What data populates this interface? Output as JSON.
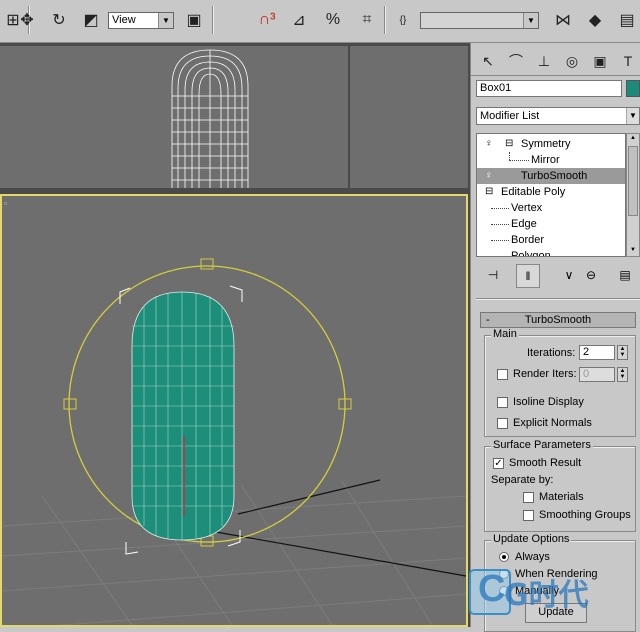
{
  "toolbar": {
    "view_select": "View",
    "named_selection": "",
    "icons": [
      "select-link-icon",
      "move-icon",
      "rotate-icon",
      "scale-icon",
      "view-dropdown",
      "use-pivot-icon",
      "snap-icon",
      "angle-snap-icon",
      "percent-snap-icon",
      "spinner-snap-icon",
      "mirror-icon",
      "align-icon",
      "named-selection-field",
      "edit-named-sel-icon",
      "material-editor-icon"
    ]
  },
  "panel": {
    "object_name": "Box01",
    "object_color": "#1a8a7a",
    "modifier_list": "Modifier List",
    "stack": [
      {
        "label": "Symmetry",
        "level": 0
      },
      {
        "label": "Mirror",
        "level": 1
      },
      {
        "label": "TurboSmooth",
        "level": 0,
        "selected": true
      },
      {
        "label": "Editable Poly",
        "level": 0
      },
      {
        "label": "Vertex",
        "level": 1
      },
      {
        "label": "Edge",
        "level": 1
      },
      {
        "label": "Border",
        "level": 1
      },
      {
        "label": "Polygon",
        "level": 1
      }
    ]
  },
  "turbosmooth": {
    "rollout_title": "TurboSmooth",
    "collapse": "-",
    "main": {
      "title": "Main",
      "iterations_label": "Iterations:",
      "iterations_value": "2",
      "render_iters_label": "Render Iters:",
      "render_iters_value": "0",
      "isoline_label": "Isoline Display",
      "explicit_label": "Explicit Normals"
    },
    "surface": {
      "title": "Surface Parameters",
      "smooth_result_label": "Smooth Result",
      "separate_by": "Separate by:",
      "materials_label": "Materials",
      "smoothing_groups_label": "Smoothing Groups"
    },
    "update": {
      "title": "Update Options",
      "always": "Always",
      "when_rendering": "When Rendering",
      "manually": "Manually",
      "update_button": "Update"
    }
  },
  "watermark": {
    "text": "G时代",
    "letter": "C"
  }
}
